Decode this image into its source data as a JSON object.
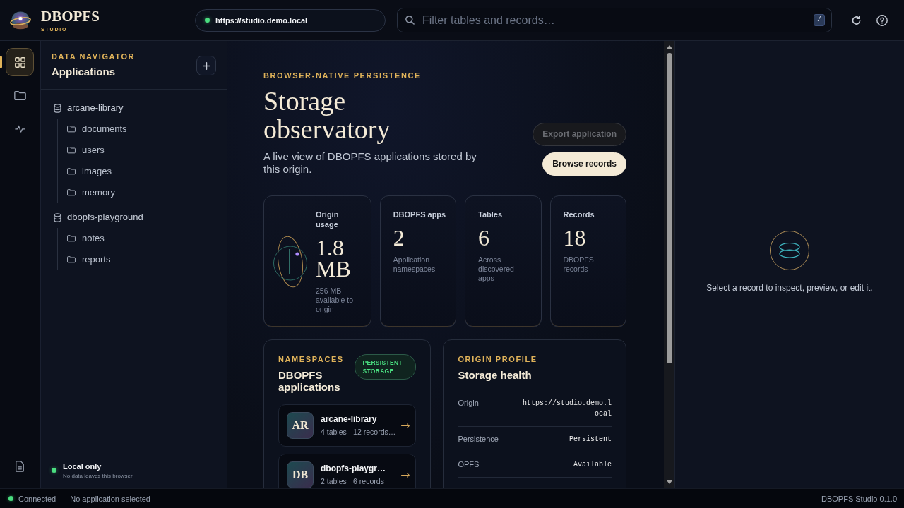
{
  "header": {
    "brand": {
      "name": "DBOPFS",
      "tagline": "STUDIO"
    },
    "origin": {
      "online": true,
      "url": "https://studio.demo.local"
    },
    "search": {
      "placeholder": "Filter tables and records…",
      "shortcut": "/"
    }
  },
  "rail": {
    "items": [
      {
        "selected": true
      },
      {
        "selected": false
      },
      {
        "selected": false
      }
    ]
  },
  "sidebar": {
    "eyebrow": "DATA NAVIGATOR",
    "title": "Applications",
    "tree": [
      {
        "kind": "app",
        "label": "arcane-library",
        "children": [
          {
            "kind": "table",
            "label": "documents"
          },
          {
            "kind": "table",
            "label": "users"
          },
          {
            "kind": "table",
            "label": "images"
          },
          {
            "kind": "table",
            "label": "memory"
          }
        ]
      },
      {
        "kind": "app",
        "label": "dbopfs-playground",
        "children": [
          {
            "kind": "table",
            "label": "notes"
          },
          {
            "kind": "table",
            "label": "reports"
          }
        ]
      }
    ],
    "footer": {
      "title": "Local only",
      "subtitle": "No data leaves this browser"
    }
  },
  "overview": {
    "eyebrow": "BROWSER-NATIVE PERSISTENCE",
    "title": "Storage observatory",
    "description": "A live view of DBOPFS applications stored by this origin.",
    "actions": [
      {
        "kind": "secondary",
        "label": "Export application",
        "disabled": true
      },
      {
        "kind": "primary",
        "label": "Browse records",
        "disabled": false
      }
    ],
    "stats": [
      {
        "kind": "usage",
        "label": "Origin usage",
        "value": "1.8 MB",
        "caption": "256 MB available to origin"
      },
      {
        "kind": "count",
        "label": "DBOPFS apps",
        "value": "2",
        "caption": "Application namespaces"
      },
      {
        "kind": "count",
        "label": "Tables",
        "value": "6",
        "caption": "Across discovered apps"
      },
      {
        "kind": "count",
        "label": "Records",
        "value": "18",
        "caption": "DBOPFS records"
      }
    ],
    "namespaces": {
      "eyebrow": "NAMESPACES",
      "title": "DBOPFS applications",
      "badge": "PERSISTENT STORAGE",
      "apps": [
        {
          "initials": "AR",
          "name": "arcane-library",
          "meta": "4 tables · 12 records…"
        },
        {
          "initials": "DB",
          "name": "dbopfs-playgr…",
          "meta": "2 tables · 6 records"
        }
      ]
    },
    "profile": {
      "eyebrow": "ORIGIN PROFILE",
      "title": "Storage health",
      "rows": [
        {
          "label": "Origin",
          "value": "https://studio.demo.local"
        },
        {
          "label": "Persistence",
          "value": "Persistent"
        },
        {
          "label": "OPFS",
          "value": "Available"
        }
      ]
    }
  },
  "inspector": {
    "message": "Select a record to inspect, preview, or edit it."
  },
  "status_bar": {
    "connected": true,
    "connection": "Connected",
    "selection": "No application selected",
    "version": "DBOPFS Studio 0.1.0"
  }
}
